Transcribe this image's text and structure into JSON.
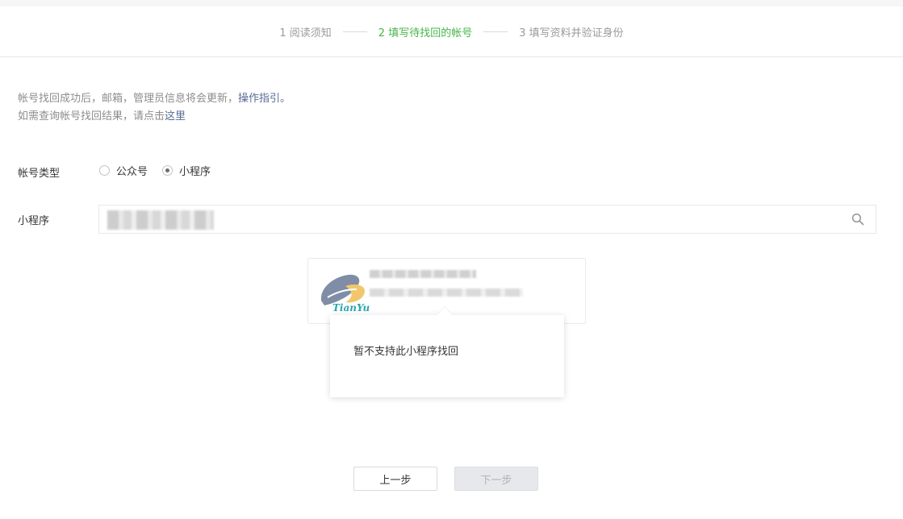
{
  "steps": [
    {
      "label": "1 阅读须知",
      "active": false
    },
    {
      "label": "2 填写待找回的帐号",
      "active": true
    },
    {
      "label": "3 填写资料并验证身份",
      "active": false
    }
  ],
  "notice": {
    "line1_prefix": "帐号找回成功后，邮箱，管理员信息将会更新，",
    "line1_link": "操作指引。",
    "line2_prefix": "如需查询帐号找回结果，请点击",
    "line2_link": "这里"
  },
  "form": {
    "account_type_label": "帐号类型",
    "options": [
      {
        "label": "公众号",
        "checked": false
      },
      {
        "label": "小程序",
        "checked": true
      }
    ],
    "miniprogram_label": "小程序"
  },
  "result": {
    "logo_text": "TianYu"
  },
  "tooltip": {
    "message": "暂不支持此小程序找回"
  },
  "buttons": {
    "prev": "上一步",
    "next": "下一步"
  },
  "colors": {
    "active_step": "#44b549",
    "link": "#576b95"
  },
  "icons": {
    "search": "magnifier"
  }
}
